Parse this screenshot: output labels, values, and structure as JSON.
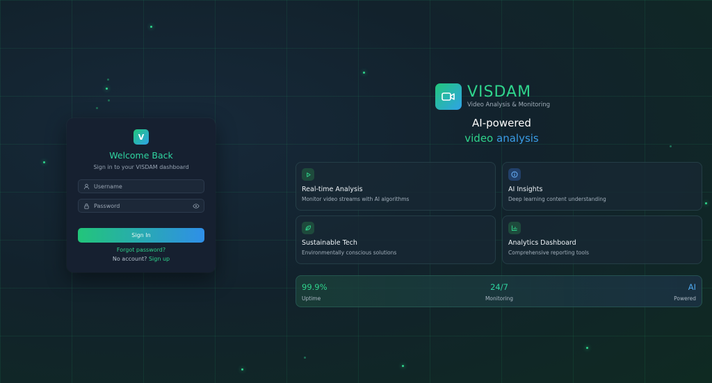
{
  "login": {
    "logo_letter": "V",
    "title": "Welcome Back",
    "subtitle": "Sign in to your VISDAM dashboard",
    "username_placeholder": "Username",
    "password_placeholder": "Password",
    "sign_in_label": "Sign In",
    "forgot_label": "Forgot password?",
    "no_account_text": "No account?",
    "sign_up_label": "Sign up"
  },
  "brand": {
    "name": "VISDAM",
    "tagline": "Video Analysis & Monitoring",
    "headline_line1": "AI-powered",
    "headline_line2_a": "video",
    "headline_line2_b": "analysis"
  },
  "features": [
    {
      "title": "Real-time Analysis",
      "desc": "Monitor video streams with AI algorithms",
      "icon": "play-icon"
    },
    {
      "title": "AI Insights",
      "desc": "Deep learning content understanding",
      "icon": "info-icon"
    },
    {
      "title": "Sustainable Tech",
      "desc": "Environmentally conscious solutions",
      "icon": "leaf-icon"
    },
    {
      "title": "Analytics Dashboard",
      "desc": "Comprehensive reporting tools",
      "icon": "bar-chart-icon"
    }
  ],
  "stats": [
    {
      "value": "99.9%",
      "label": "Uptime"
    },
    {
      "value": "24/7",
      "label": "Monitoring"
    },
    {
      "value": "AI",
      "label": "Powered"
    }
  ],
  "colors": {
    "accent_green": "#2fd48c",
    "accent_blue": "#2f8fe8",
    "card_bg": "#162030"
  }
}
